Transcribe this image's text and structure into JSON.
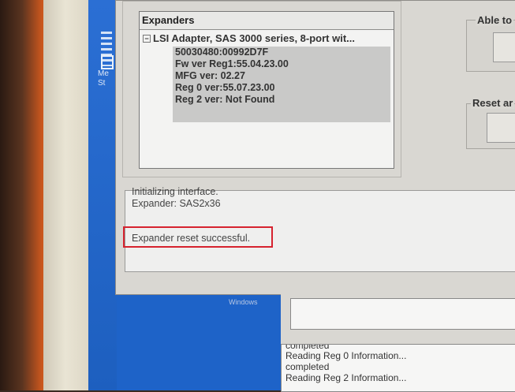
{
  "tree": {
    "header": "Expanders",
    "root_label": "LSI Adapter, SAS 3000 series, 8-port wit...",
    "expand_glyph": "−",
    "children": [
      "50030480:00992D7F",
      "Fw ver Reg1:55.04.23.00",
      "MFG ver: 02.27",
      "Reg 0 ver:55.07.23.00",
      "Reg 2 ver: Not Found"
    ]
  },
  "side_groups": {
    "able_title": "Able to",
    "reset_title": "Reset ar"
  },
  "log": {
    "lines": [
      "Initializing interface.",
      "Expander: SAS2x36",
      "",
      "Expander reset successful."
    ]
  },
  "desktop": {
    "label_me": "Me",
    "label_st": "St",
    "windows_label": "Windows"
  },
  "lower_log": {
    "lines": [
      "completed",
      "Reading Reg 0 Information...",
      "completed",
      "Reading Reg 2 Information..."
    ]
  }
}
